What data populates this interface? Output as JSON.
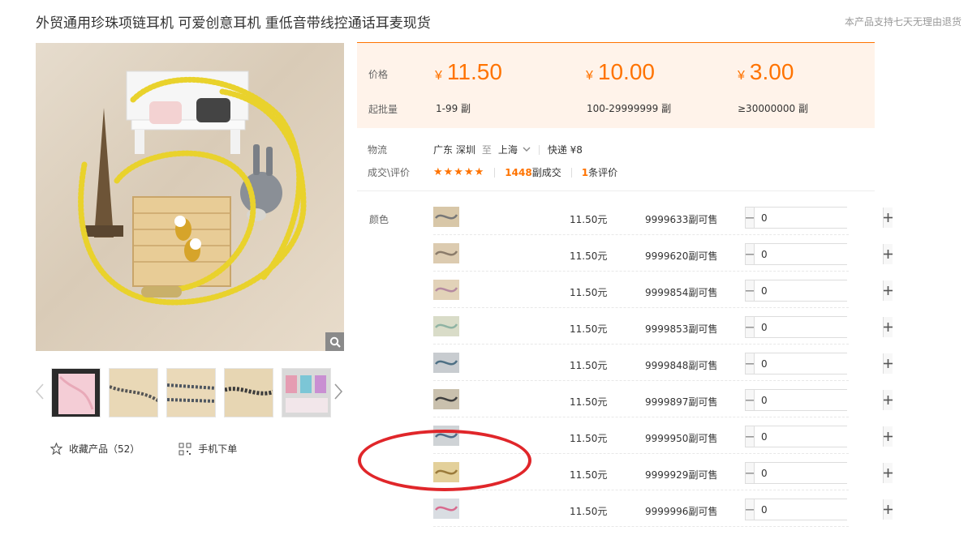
{
  "product": {
    "title": "外贸通用珍珠项链耳机 可爱创意耳机 重低音带线控通话耳麦现货",
    "return_note": "本产品支持七天无理由退货"
  },
  "gallery": {
    "zoom_icon": "magnifier-icon",
    "thumbnails": [
      "thumb-1",
      "thumb-2",
      "thumb-3",
      "thumb-4",
      "thumb-5"
    ]
  },
  "actions": {
    "favorite_label": "收藏产品（52）",
    "mobile_order_label": "手机下单"
  },
  "price_panel": {
    "price_label": "价格",
    "min_qty_label": "起批量",
    "currency": "¥",
    "tiers": [
      {
        "price": "11.50",
        "range": "1-99 副"
      },
      {
        "price": "10.00",
        "range": "100-29999999 副"
      },
      {
        "price": "3.00",
        "range": "≥30000000 副"
      }
    ],
    "accent_color": "#ff7300"
  },
  "logistics": {
    "label": "物流",
    "from": "广东 深圳",
    "to_word": "至",
    "to": "上海",
    "shipping": "快递 ¥8"
  },
  "deal": {
    "label": "成交\\评价",
    "stars": "★★★★★",
    "deal_count": "1448",
    "deal_suffix": "副成交",
    "review_count": "1",
    "review_suffix": "条评价"
  },
  "sku": {
    "label": "颜色",
    "rows": [
      {
        "price": "11.50元",
        "stock": "9999633副可售",
        "qty": "0"
      },
      {
        "price": "11.50元",
        "stock": "9999620副可售",
        "qty": "0"
      },
      {
        "price": "11.50元",
        "stock": "9999854副可售",
        "qty": "0"
      },
      {
        "price": "11.50元",
        "stock": "9999853副可售",
        "qty": "0"
      },
      {
        "price": "11.50元",
        "stock": "9999848副可售",
        "qty": "0"
      },
      {
        "price": "11.50元",
        "stock": "9999897副可售",
        "qty": "0"
      },
      {
        "price": "11.50元",
        "stock": "9999950副可售",
        "qty": "0"
      },
      {
        "price": "11.50元",
        "stock": "9999929副可售",
        "qty": "0"
      },
      {
        "price": "11.50元",
        "stock": "9999996副可售",
        "qty": "0"
      }
    ]
  }
}
